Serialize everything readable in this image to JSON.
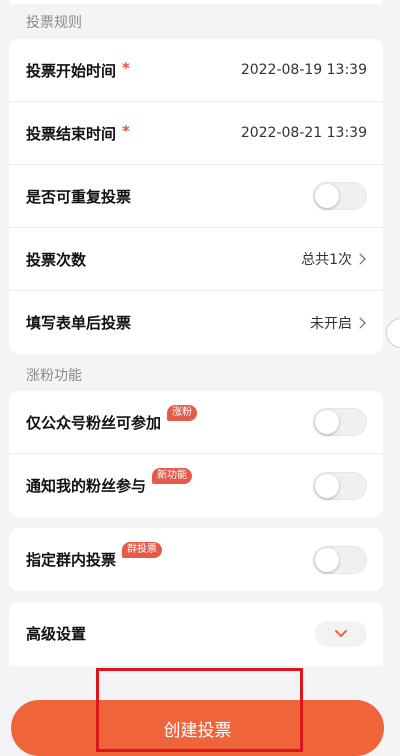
{
  "sections": {
    "rules_title": "投票规则",
    "fans_title": "涨粉功能"
  },
  "rules": {
    "start_time_label": "投票开始时间",
    "start_time_value": "2022-08-19 13:39",
    "end_time_label": "投票结束时间",
    "end_time_value": "2022-08-21 13:39",
    "required_mark": "*",
    "repeat_label": "是否可重复投票",
    "repeat_enabled": false,
    "vote_count_label": "投票次数",
    "vote_count_value": "总共1次",
    "form_label": "填写表单后投票",
    "form_value": "未开启"
  },
  "fans": {
    "followers_only_label": "仅公众号粉丝可参加",
    "followers_only_badge": "涨粉",
    "followers_only_enabled": false,
    "notify_fans_label": "通知我的粉丝参与",
    "notify_fans_badge": "新功能",
    "notify_fans_enabled": false
  },
  "group": {
    "group_vote_label": "指定群内投票",
    "group_vote_badge": "群投票",
    "group_vote_enabled": false
  },
  "advanced": {
    "label": "高级设置"
  },
  "footer": {
    "create_button_label": "创建投票"
  },
  "colors": {
    "accent": "#f0643a",
    "badge": "#e45b49",
    "required": "#e8503a",
    "highlight": "#e0141c"
  }
}
